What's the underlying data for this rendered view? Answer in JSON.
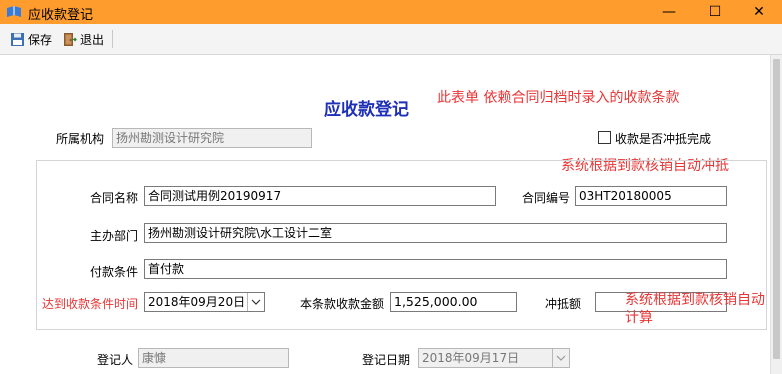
{
  "window": {
    "title": "应收款登记",
    "minimize": "—",
    "maximize": "☐",
    "close": "✕"
  },
  "toolbar": {
    "save_label": "保存",
    "exit_label": "退出"
  },
  "form": {
    "title": "应收款登记",
    "org_label": "所属机构",
    "org_value": "扬州勘测设计研究院",
    "offset_done_label": "收款是否冲抵完成",
    "contract_name_label": "合同名称",
    "contract_name_value": "合同测试用例20190917",
    "contract_no_label": "合同编号",
    "contract_no_value": "03HT20180005",
    "dept_label": "主办部门",
    "dept_value": "扬州勘测设计研究院\\水工设计二室",
    "terms_label": "付款条件",
    "terms_value": "首付款",
    "date_label": "达到收款条件时间",
    "date_value": "2018年09月20日",
    "amount_label": "本条款收款金额",
    "amount_value": "1,525,000.00",
    "offset_label": "冲抵额",
    "offset_value": "",
    "registrar_label": "登记人",
    "registrar_value": "康慷",
    "reg_date_label": "登记日期",
    "reg_date_value": "2018年09月17日"
  },
  "annotations": {
    "note1": "此表单 依赖合同归档时录入的收款条款",
    "note2": "系统根据到款核销自动冲抵",
    "note3_line1": "系统根据到款核销自动",
    "note3_line2": "计算"
  },
  "colors": {
    "titlebar": "#ff9c2e",
    "title_blue": "#1e2fb8",
    "note_red": "#e83535"
  }
}
